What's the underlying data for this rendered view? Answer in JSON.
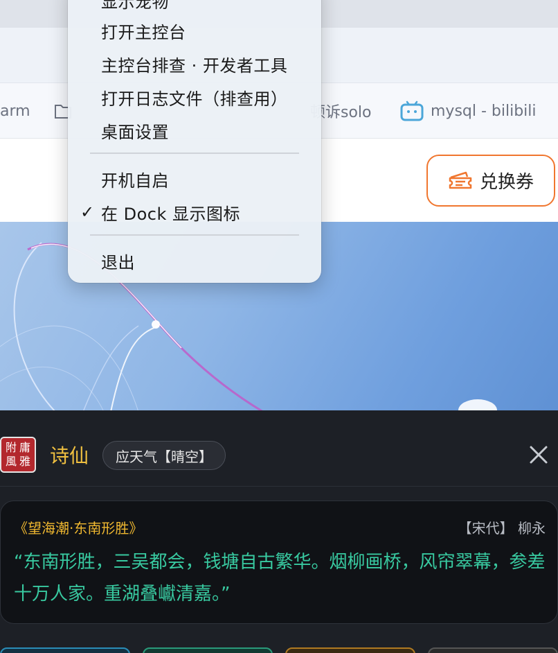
{
  "bookmarks": [
    {
      "label": "arm"
    },
    {
      "label": ""
    },
    {
      "label": "顿诉solo"
    },
    {
      "label": "mysql -  bilibili"
    }
  ],
  "header": {
    "coupon_label": "兑换券"
  },
  "menu": {
    "items": [
      {
        "label": "显示宠物"
      },
      {
        "label": "打开主控台"
      },
      {
        "label": "主控台排查 · 开发者工具"
      },
      {
        "label": "打开日志文件（排查用）"
      },
      {
        "label": "桌面设置"
      },
      {
        "label": "开机自启"
      },
      {
        "label": "在 Dock 显示图标",
        "checked": true
      },
      {
        "label": "退出"
      }
    ],
    "check_mark": "✓"
  },
  "panel": {
    "seal_chars": [
      "附",
      "庸",
      "風",
      "雅"
    ],
    "title": "诗仙",
    "weather": "应天气【晴空】",
    "poem": {
      "title": "《望海潮·东南形胜》",
      "author": "【宋代】 柳永",
      "text": "“东南形胜，三吴都会，钱塘自古繁华。烟柳画桥，风帘翠幕，参差十万人家。重湖叠巘清嘉。”"
    }
  },
  "colors": {
    "accent_orange": "#f0762e",
    "poem_green": "#38c9a0",
    "title_gold": "#f0c040"
  }
}
